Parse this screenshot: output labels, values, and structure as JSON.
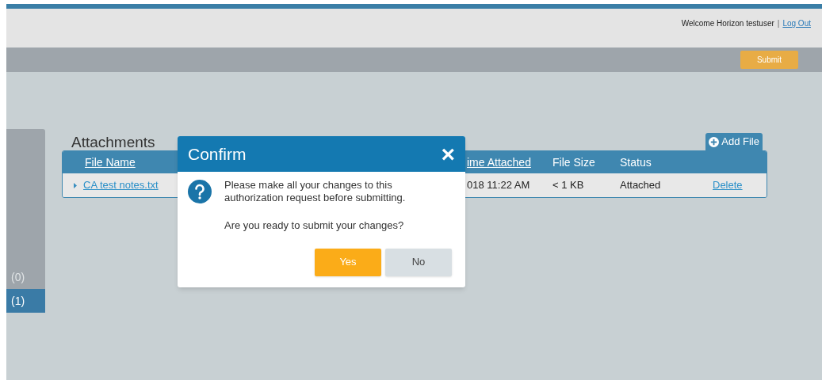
{
  "header": {
    "welcome": "Welcome Horizon testuser",
    "separator": "|",
    "logout": "Log Out"
  },
  "toolbar": {
    "submit": "Submit"
  },
  "sidebar": {
    "items": [
      {
        "label": "(0)",
        "selected": false
      },
      {
        "label": "(1)",
        "selected": true
      }
    ]
  },
  "attachments": {
    "title": "Attachments",
    "add_file": "Add File",
    "columns": [
      "File Name",
      "ime Attached",
      "File Size",
      "Status"
    ],
    "rows": [
      {
        "file_name": "CA test notes.txt",
        "time_attached": "018 11:22 AM",
        "file_size": "< 1 KB",
        "status": "Attached",
        "action": "Delete"
      }
    ]
  },
  "dialog": {
    "title": "Confirm",
    "close": "×",
    "message": "Please make all your changes to this authorization request before submitting.",
    "question": "Are you ready to submit your changes?",
    "buttons": [
      {
        "label": "Yes",
        "kind": "primary"
      },
      {
        "label": "No",
        "kind": "secondary"
      }
    ]
  }
}
